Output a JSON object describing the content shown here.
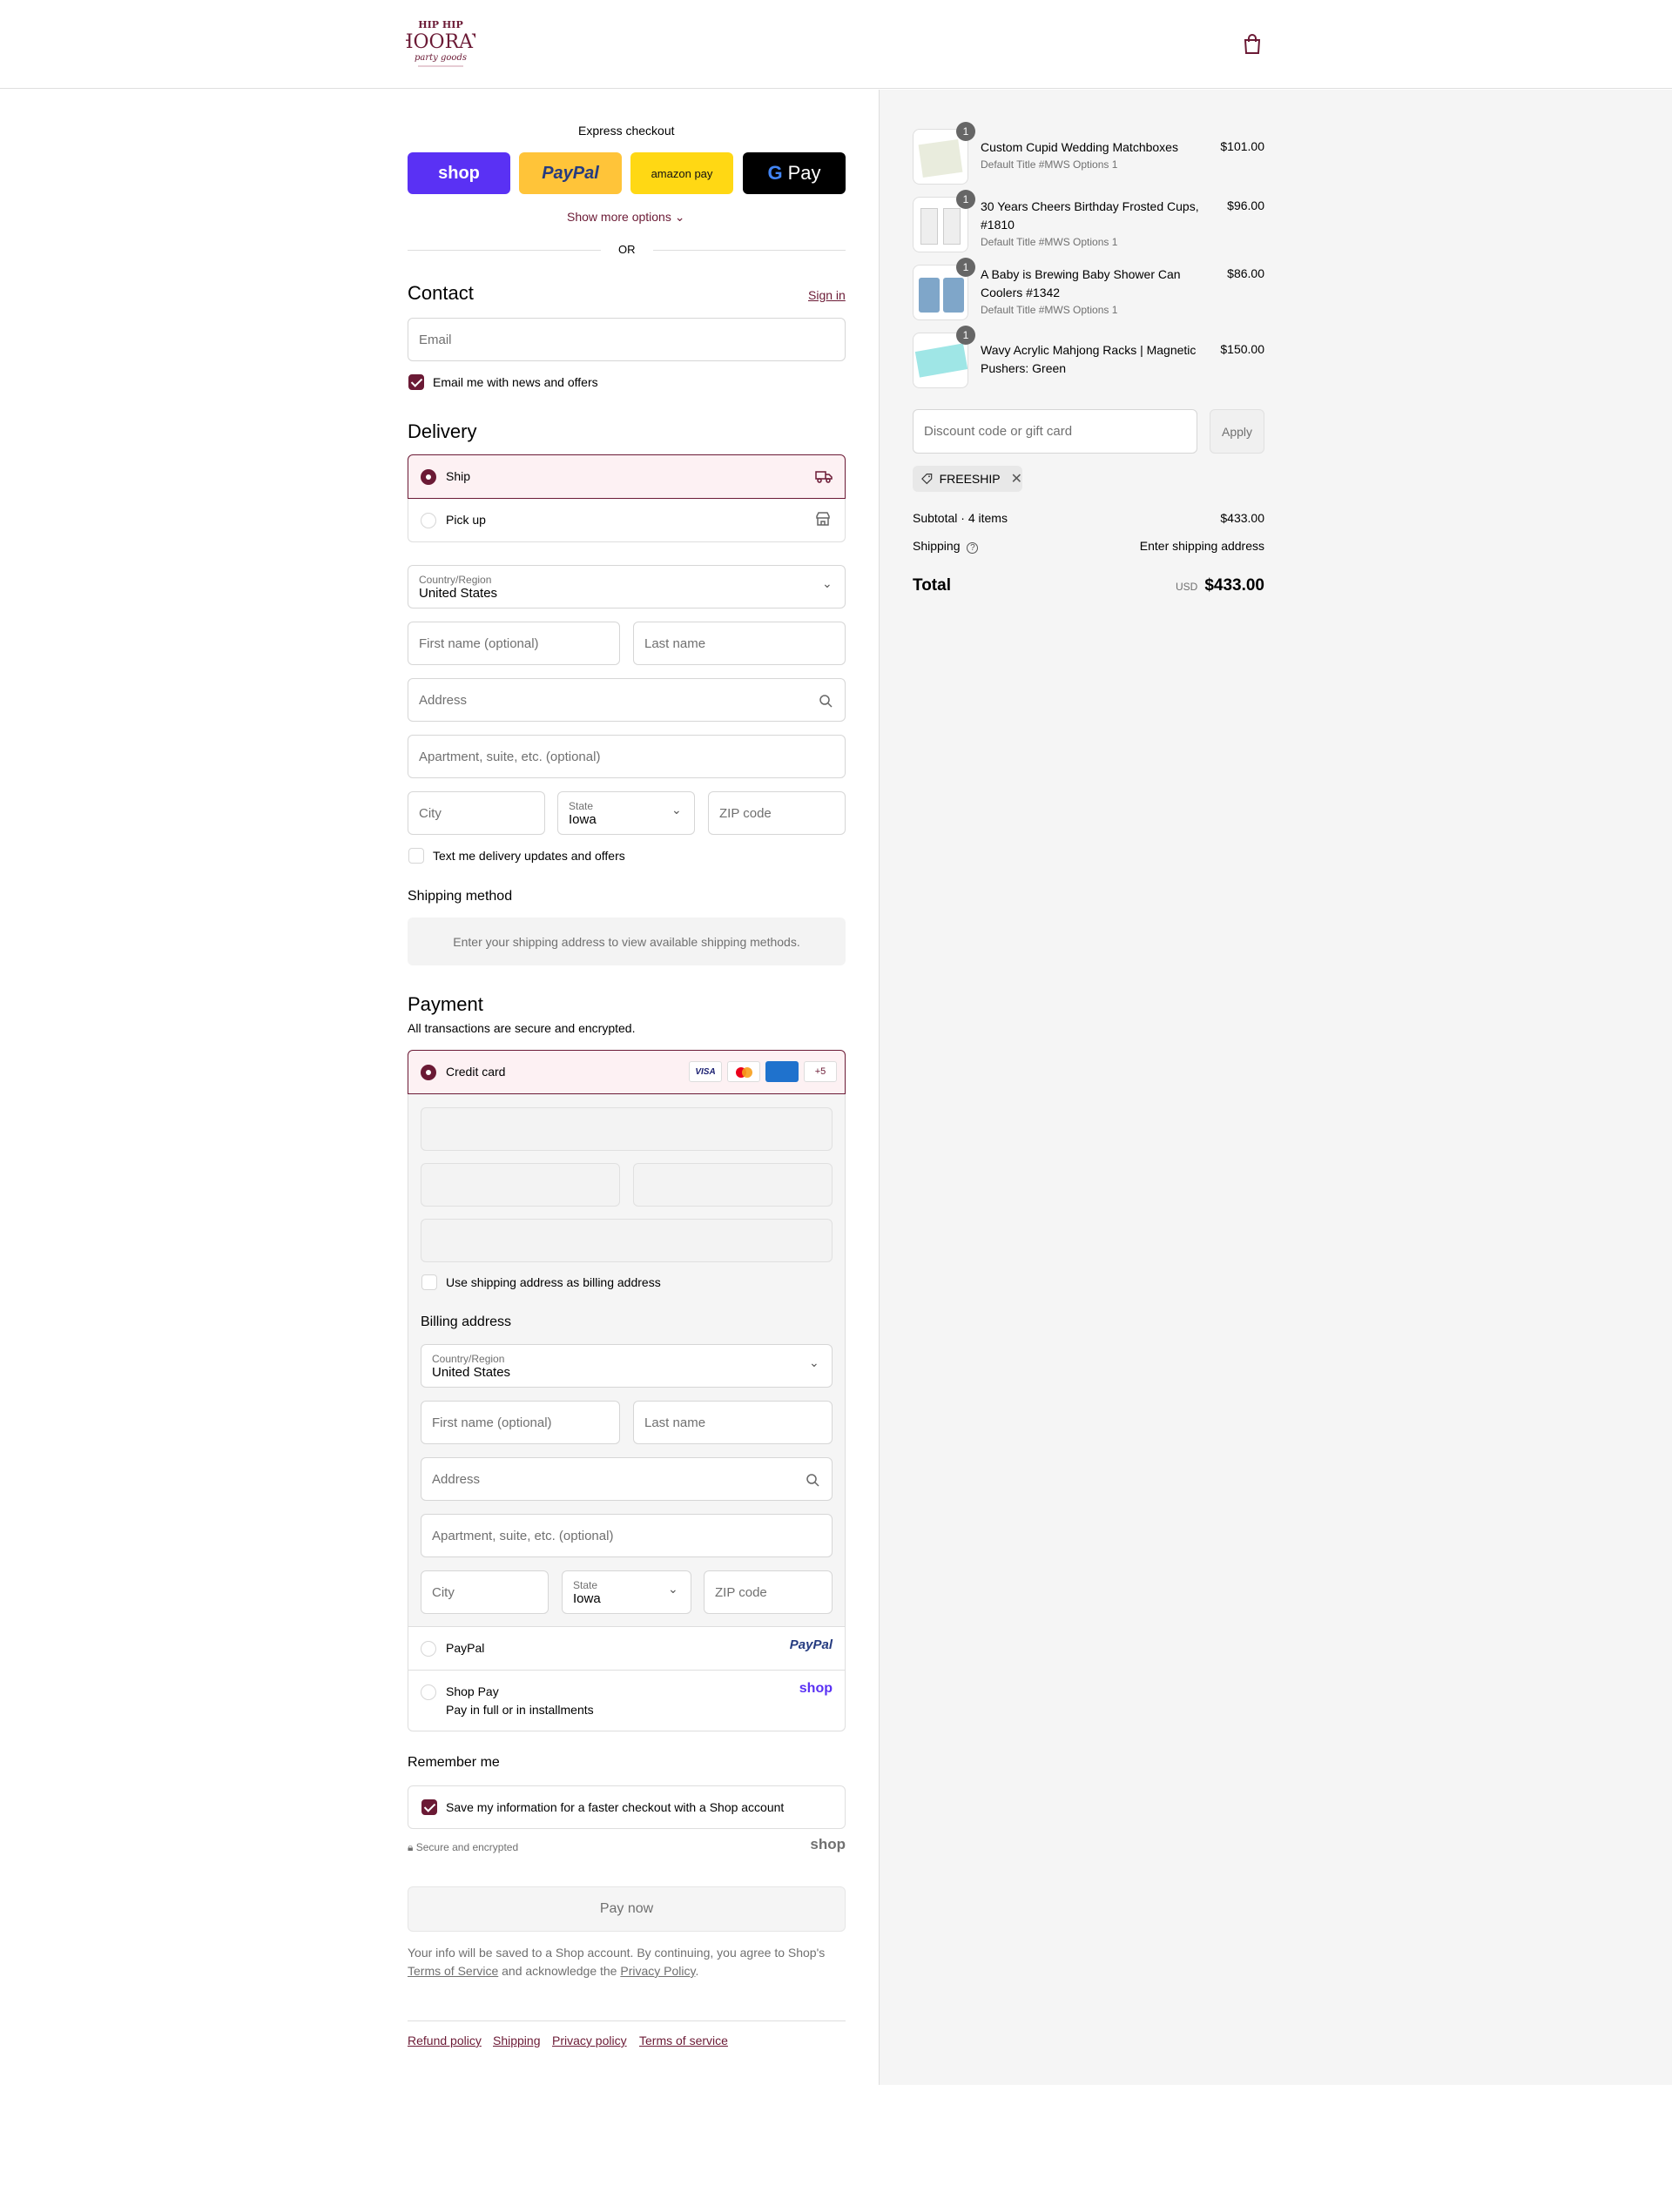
{
  "express": {
    "title": "Express checkout",
    "shop_label": "shop",
    "paypal_label": "PayPal",
    "amazon_label": "amazon pay",
    "gpay_label": "Pay",
    "more_options": "Show more options",
    "or": "OR"
  },
  "contact": {
    "title": "Contact",
    "sign_in": "Sign in",
    "email_placeholder": "Email",
    "news_label": "Email me with news and offers",
    "news_checked": true
  },
  "delivery": {
    "title": "Delivery",
    "options": [
      {
        "label": "Ship",
        "selected": true
      },
      {
        "label": "Pick up",
        "selected": false
      }
    ],
    "country_label": "Country/Region",
    "country_value": "United States",
    "first_name_placeholder": "First name (optional)",
    "last_name_placeholder": "Last name",
    "address_placeholder": "Address",
    "apt_placeholder": "Apartment, suite, etc. (optional)",
    "city_placeholder": "City",
    "state_label": "State",
    "state_value": "Iowa",
    "zip_placeholder": "ZIP code",
    "sms_label": "Text me delivery updates and offers"
  },
  "shipping_method": {
    "title": "Shipping method",
    "notice": "Enter your shipping address to view available shipping methods."
  },
  "payment": {
    "title": "Payment",
    "subtitle": "All transactions are secure and encrypted.",
    "credit_card_label": "Credit card",
    "card_badges": [
      "VISA",
      "+5"
    ],
    "use_shipping_label": "Use shipping address as billing address",
    "billing_title": "Billing address",
    "billing": {
      "country_label": "Country/Region",
      "country_value": "United States",
      "first_name_placeholder": "First name (optional)",
      "last_name_placeholder": "Last name",
      "address_placeholder": "Address",
      "apt_placeholder": "Apartment, suite, etc. (optional)",
      "city_placeholder": "City",
      "state_label": "State",
      "state_value": "Iowa",
      "zip_placeholder": "ZIP code"
    },
    "paypal_label": "PayPal",
    "paypal_logo": "PayPal",
    "shoppay_label": "Shop Pay",
    "shoppay_sub": "Pay in full or in installments",
    "shop_logo": "shop"
  },
  "remember": {
    "title": "Remember me",
    "save_label": "Save my information for a faster checkout with a Shop account",
    "secure": "Secure and encrypted",
    "shop_logo": "shop"
  },
  "pay_now": "Pay now",
  "legal": {
    "line1": "Your info will be saved to a Shop account. By continuing, you agree to Shop's",
    "terms": "Terms of Service",
    "mid": "and acknowledge the",
    "privacy": "Privacy Policy",
    "end": "."
  },
  "footer_links": [
    "Refund policy",
    "Shipping",
    "Privacy policy",
    "Terms of service"
  ],
  "cart": {
    "items": [
      {
        "qty": "1",
        "name": "Custom Cupid Wedding Matchboxes",
        "variant": "Default Title #MWS Options 1",
        "price": "$101.00"
      },
      {
        "qty": "1",
        "name": "30 Years Cheers Birthday Frosted Cups, #1810",
        "variant": "Default Title #MWS Options 1",
        "price": "$96.00"
      },
      {
        "qty": "1",
        "name": "A Baby is Brewing Baby Shower Can Coolers #1342",
        "variant": "Default Title #MWS Options 1",
        "price": "$86.00"
      },
      {
        "qty": "1",
        "name": "Wavy Acrylic Mahjong Racks | Magnetic Pushers: Green",
        "variant": "",
        "price": "$150.00"
      }
    ],
    "discount_placeholder": "Discount code or gift card",
    "apply": "Apply",
    "code": "FREESHIP",
    "subtotal_label": "Subtotal · 4 items",
    "subtotal_value": "$433.00",
    "shipping_label": "Shipping",
    "shipping_value": "Enter shipping address",
    "total_label": "Total",
    "currency": "USD",
    "total_value": "$433.00"
  },
  "colors": {
    "brand": "#6b1a35",
    "shop_purple": "#5a31f4",
    "paypal_yellow": "#ffc439",
    "amazon_yellow": "#ffd814"
  }
}
